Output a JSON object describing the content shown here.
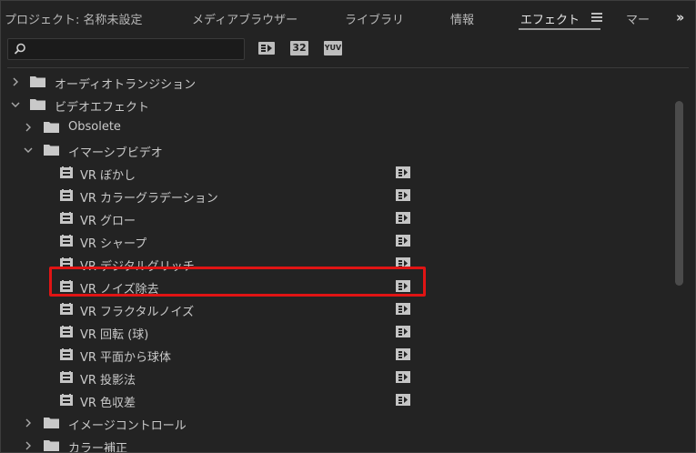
{
  "tabs": [
    {
      "label": "プロジェクト: 名称未設定"
    },
    {
      "label": "メディアブラウザー"
    },
    {
      "label": "ライブラリ"
    },
    {
      "label": "情報"
    },
    {
      "label": "エフェクト"
    },
    {
      "label": "マー"
    }
  ],
  "active_tab": "エフェクト",
  "search": {
    "value": "",
    "placeholder": ""
  },
  "toolbar": {
    "btn1_icon": "accelerated-effects-icon",
    "btn2_text": "32",
    "btn3_text": "YUV"
  },
  "tree": {
    "items": [
      {
        "label": "オーディオトランジション",
        "type": "folder",
        "state": "collapsed",
        "level": 0
      },
      {
        "label": "ビデオエフェクト",
        "type": "folder",
        "state": "expanded",
        "level": 0
      },
      {
        "label": "Obsolete",
        "type": "folder",
        "state": "collapsed",
        "level": 1
      },
      {
        "label": "イマーシブビデオ",
        "type": "folder",
        "state": "expanded",
        "level": 1
      },
      {
        "label": "VR ぼかし",
        "type": "effect",
        "level": 2
      },
      {
        "label": "VR カラーグラデーション",
        "type": "effect",
        "level": 2
      },
      {
        "label": "VR グロー",
        "type": "effect",
        "level": 2
      },
      {
        "label": "VR シャープ",
        "type": "effect",
        "level": 2
      },
      {
        "label": "VR デジタルグリッチ",
        "type": "effect",
        "level": 2
      },
      {
        "label": "VR ノイズ除去",
        "type": "effect",
        "level": 2,
        "highlighted": true
      },
      {
        "label": "VR フラクタルノイズ",
        "type": "effect",
        "level": 2
      },
      {
        "label": "VR 回転 (球)",
        "type": "effect",
        "level": 2
      },
      {
        "label": "VR 平面から球体",
        "type": "effect",
        "level": 2
      },
      {
        "label": "VR 投影法",
        "type": "effect",
        "level": 2
      },
      {
        "label": "VR 色収差",
        "type": "effect",
        "level": 2
      },
      {
        "label": "イメージコントロール",
        "type": "folder",
        "state": "collapsed",
        "level": 1
      },
      {
        "label": "カラー補正",
        "type": "folder",
        "state": "collapsed",
        "level": 1
      }
    ]
  },
  "colors": {
    "background": "#232323",
    "text": "#cacaca",
    "highlight_border": "#e01414"
  }
}
